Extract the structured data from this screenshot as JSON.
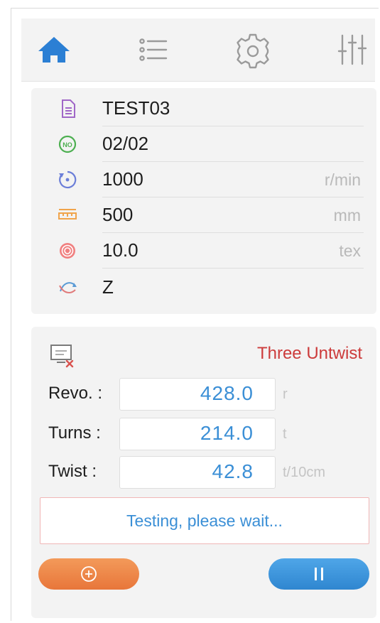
{
  "navbar": {
    "items": [
      {
        "icon": "home-icon",
        "color": "#2b7fd4"
      },
      {
        "icon": "list-icon",
        "color": "#9a9a9a"
      },
      {
        "icon": "settings-icon",
        "color": "#9a9a9a"
      },
      {
        "icon": "sliders-icon",
        "color": "#9a9a9a"
      }
    ]
  },
  "info": {
    "rows": [
      {
        "icon": "document-icon",
        "value": "TEST03",
        "unit": ""
      },
      {
        "icon": "number-badge-icon",
        "icon_text": "NO",
        "value": "02/02",
        "unit": ""
      },
      {
        "icon": "rotation-icon",
        "value": "1000",
        "unit": "r/min"
      },
      {
        "icon": "length-ruler-icon",
        "value": "500",
        "unit": "mm"
      },
      {
        "icon": "yarn-target-icon",
        "value": "10.0",
        "unit": "tex"
      },
      {
        "icon": "twist-direction-icon",
        "value": "Z",
        "unit": ""
      }
    ]
  },
  "test": {
    "mode_label": "Three Untwist",
    "measurements": [
      {
        "label": "Revo. :",
        "value": "428.0",
        "unit": "r"
      },
      {
        "label": "Turns :",
        "value": "214.0",
        "unit": "t"
      },
      {
        "label": "Twist :",
        "value": "42.8",
        "unit": "t/10cm"
      }
    ],
    "status": "Testing, please wait..."
  },
  "colors": {
    "accent_blue": "#3b8fd6",
    "mode_red": "#cc3b3b",
    "start_orange": "#ee8548",
    "pause_blue": "#3a93dc"
  }
}
